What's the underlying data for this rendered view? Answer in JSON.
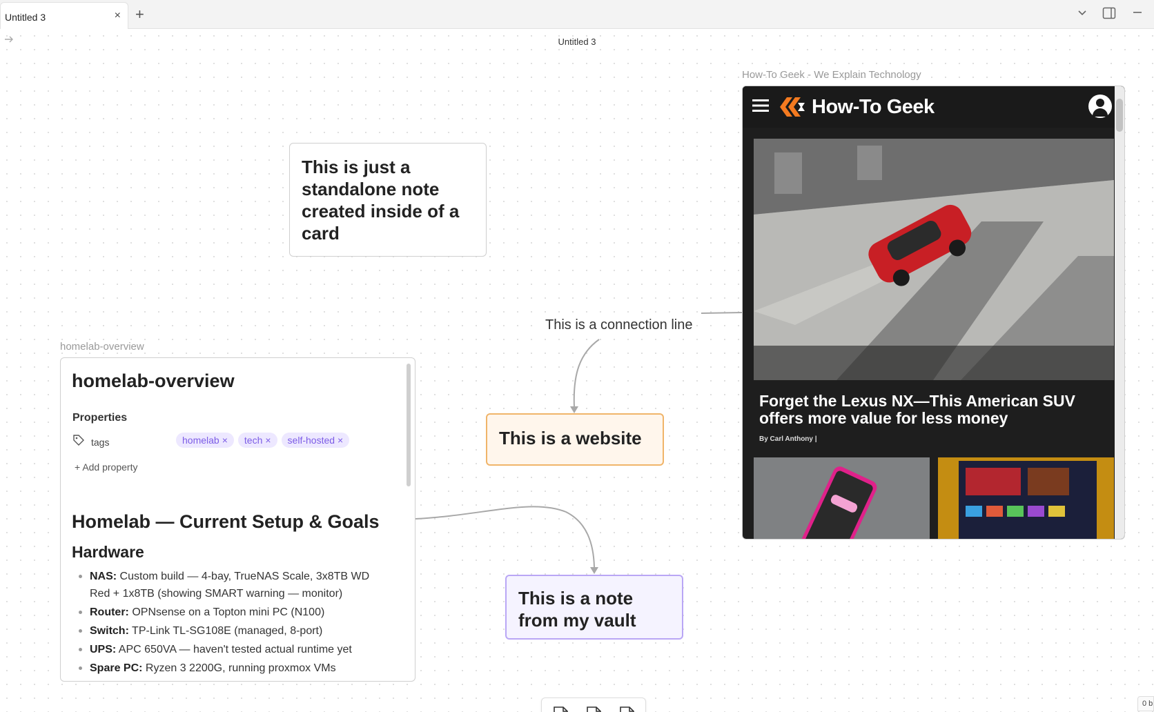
{
  "tabbar": {
    "tab_title": "Untitled 3",
    "close_glyph": "×",
    "new_tab_glyph": "+"
  },
  "canvas": {
    "title": "Untitled 3",
    "standalone_card": {
      "text": "This is just a standalone note created inside of a card"
    },
    "connection_label": "This is a connection line",
    "website_card": {
      "text": "This is a website"
    },
    "vault_card": {
      "text": "This is a note from my vault"
    },
    "note_embed": {
      "label": "homelab-overview",
      "title": "homelab-overview",
      "properties_heading": "Properties",
      "tags_key": "tags",
      "tags": [
        "homelab",
        "tech",
        "self-hosted"
      ],
      "add_property": "Add property",
      "h1": "Homelab — Current Setup & Goals",
      "h2": "Hardware",
      "hardware": [
        {
          "label": "NAS:",
          "text": " Custom build — 4-bay, TrueNAS Scale, 3x8TB WD Red + 1x8TB (showing SMART warning — monitor)"
        },
        {
          "label": "Router:",
          "text": " OPNsense on a Topton mini PC (N100)"
        },
        {
          "label": "Switch:",
          "text": " TP-Link TL-SG108E (managed, 8-port)"
        },
        {
          "label": "UPS:",
          "text": " APC 650VA — haven't tested actual runtime yet"
        },
        {
          "label": "Spare PC:",
          "text": " Ryzen 3 2200G, running proxmox VMs"
        }
      ]
    },
    "web_embed": {
      "label": "How-To Geek - We Explain Technology",
      "site_name": "How-To Geek",
      "article_title": "Forget the Lexus NX—This American SUV offers more value for less money",
      "byline": "By Carl Anthony  |"
    },
    "status_corner": "0 b"
  },
  "colors": {
    "website_card_bg": "#fff6ec",
    "website_card_border": "#f0b469",
    "vault_card_bg": "#f5f3ff",
    "vault_card_border": "#b9a6f5",
    "tag_pill_bg": "#ede8ff",
    "tag_pill_text": "#7c5ce6",
    "logo_orange": "#f47a20"
  },
  "icons": {
    "tab_close": "close-icon",
    "new_tab": "plus-icon",
    "forward": "arrow-right-icon",
    "chevron": "chevron-down-icon",
    "sidebar_toggle": "sidebar-toggle-icon",
    "minimize": "minimize-icon",
    "tags": "tag-icon",
    "add_property": "plus-icon",
    "toolbar": [
      "blank-card-icon",
      "note-card-icon",
      "media-card-icon"
    ]
  }
}
